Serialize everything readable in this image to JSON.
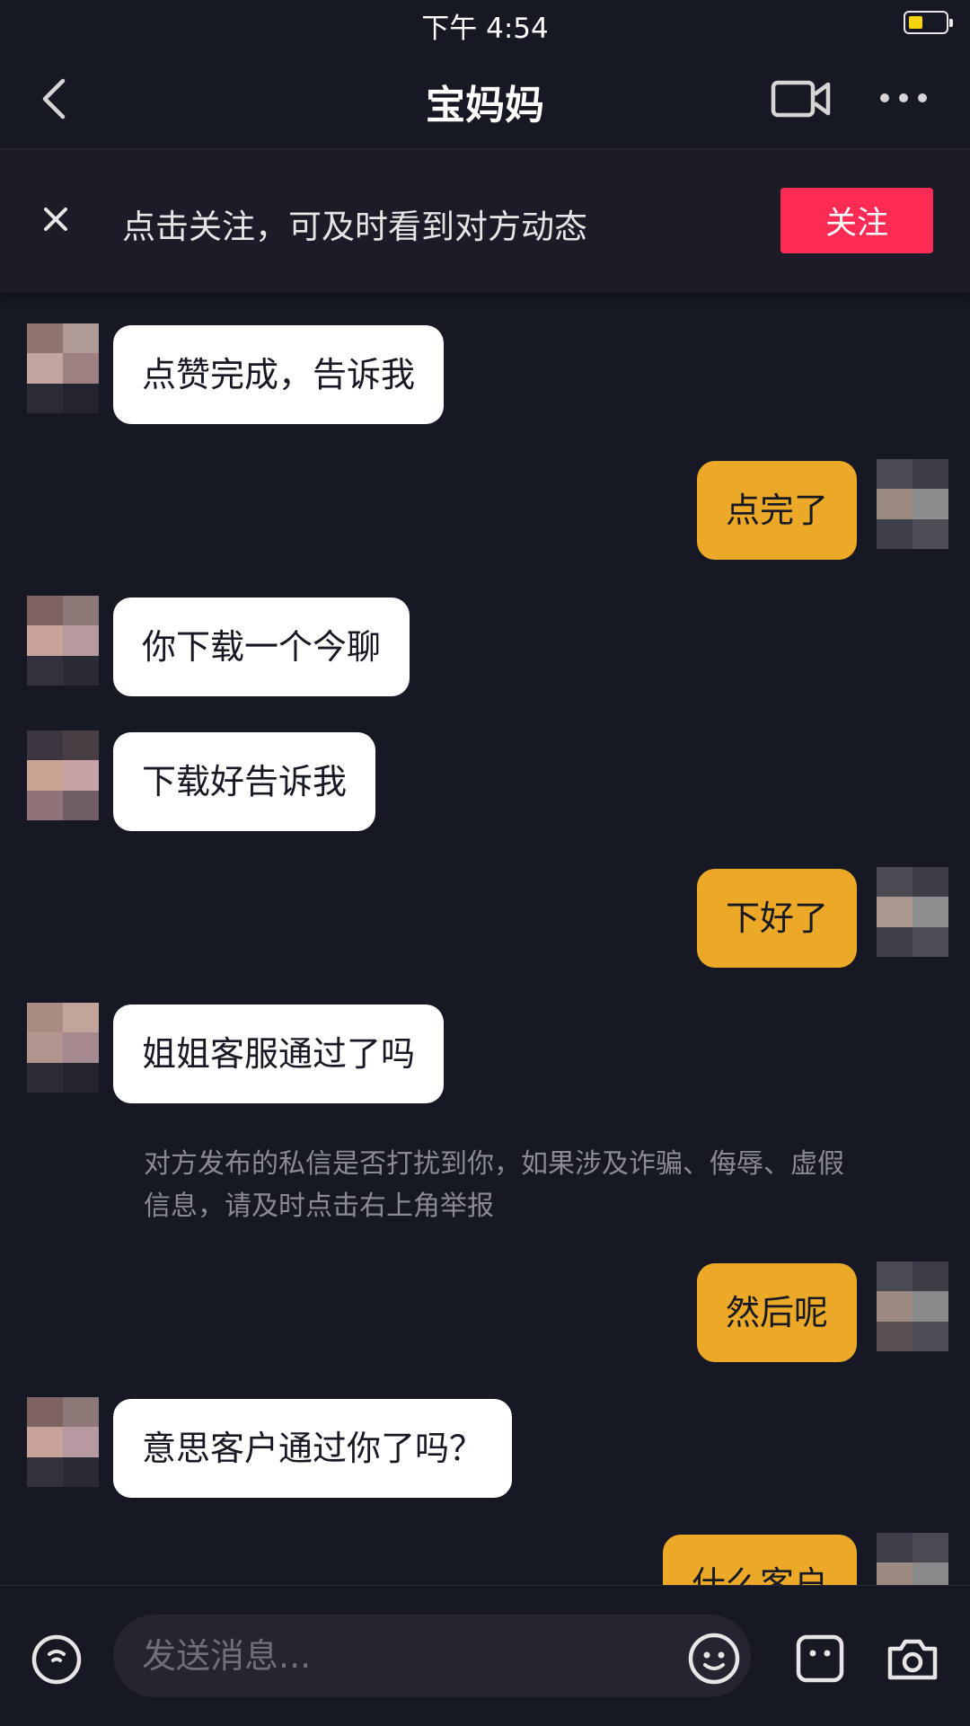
{
  "status_bar": {
    "time": "下午 4:54",
    "battery_icon": "battery-icon"
  },
  "header": {
    "title": "宝妈妈",
    "back_icon": "back-chevron-icon",
    "video_icon": "video-call-icon",
    "more_icon": "more-dots-icon"
  },
  "follow_prompt": {
    "text": "点击关注，可及时看到对方动态",
    "button_label": "关注",
    "close_icon": "close-icon",
    "button_color": "#fe2c55"
  },
  "messages": [
    {
      "direction": "incoming",
      "text": "点赞完成，告诉我"
    },
    {
      "direction": "outgoing",
      "text": "点完了"
    },
    {
      "direction": "incoming",
      "text": "你下载一个今聊"
    },
    {
      "direction": "incoming",
      "text": "下载好告诉我"
    },
    {
      "direction": "outgoing",
      "text": "下好了"
    },
    {
      "direction": "incoming",
      "text": "姐姐客服通过了吗"
    },
    {
      "direction": "outgoing",
      "text": "然后呢"
    },
    {
      "direction": "incoming",
      "text": "意思客户通过你了吗？"
    },
    {
      "direction": "outgoing",
      "text": "什么客户"
    }
  ],
  "system_notice": "对方发布的私信是否打扰到你，如果涉及诈骗、侮辱、虚假信息，请及时点击右上角举报",
  "composer": {
    "placeholder": "发送消息...",
    "voice_icon": "voice-icon",
    "emoji_icon": "emoji-icon",
    "sticker_icon": "sticker-icon",
    "camera_icon": "camera-icon"
  },
  "colors": {
    "background": "#161823",
    "outgoing_bubble": "#eca928",
    "incoming_bubble": "#ffffff",
    "follow_button": "#fe2c55"
  }
}
